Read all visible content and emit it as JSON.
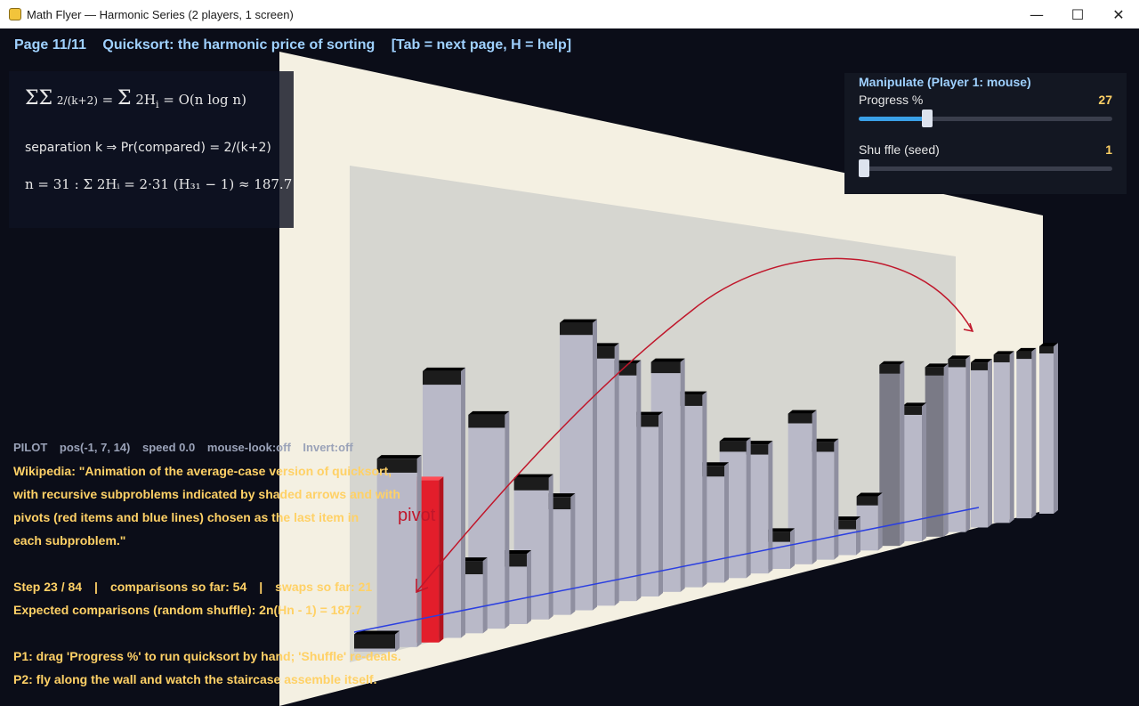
{
  "window": {
    "title": "Math Flyer — Harmonic Series (2 players, 1 screen)",
    "minimize_glyph": "—",
    "maximize_glyph": "☐",
    "close_glyph": "✕",
    "icon": "python-icon"
  },
  "header": {
    "page": "Page 11/11",
    "title": "Quicksort: the harmonic price of sorting",
    "hint": "[Tab = next page,  H = help]"
  },
  "formulas": {
    "f1_rhs": "= O(n log n)",
    "f2_text": "separation k ⇒ Pr(compared) = 2/(k+2)",
    "f3_text": "n = 31 : Σ 2Hᵢ = 2·31 (H₃₁ − 1) ≈ 187.7"
  },
  "manipulate": {
    "title": "Manipulate  (Player 1: mouse)",
    "progress_label": "Progress %",
    "progress_value": 27,
    "shuffle_label": "Shu ffle (seed)",
    "shuffle_value": 1,
    "shuffle_min": 1,
    "shuffle_max": 100
  },
  "pilot": {
    "label": "PILOT",
    "pos": "pos(-1, 7, 14)",
    "speed": "speed 0.0",
    "mouse_look": "mouse-look:off",
    "invert": "Invert:off"
  },
  "wiki": {
    "line1": "Wikipedia: \"Animation of the average-case version of quicksort,",
    "line2": "with recursive subproblems indicated by shaded arrows and with",
    "line3": "pivots (red items and blue lines) chosen as the last item in",
    "line4": "each subproblem.\""
  },
  "stats": {
    "step": "Step 23 / 84",
    "sep1": "|",
    "comparisons": "comparisons so far: 54",
    "sep2": "|",
    "swaps": "swaps so far: 21",
    "expected": "Expected comparisons (random shuffle): 2n(Hn - 1) = 187.7"
  },
  "instructions": {
    "p1": "P1: drag 'Progress %' to run quicksort by hand; 'Shuffle' re-deals.",
    "p2": "P2: fly along the wall and watch the staircase assemble itself."
  },
  "scene": {
    "pivot_label": "pivot",
    "wall_color": "#f4f0e2",
    "panel_color": "#d6d6d0",
    "bar_face": "#b9b9c8",
    "bar_cap": "#1c1c1c",
    "pivot_color": "#e31e2b",
    "arrow_color": "#c0172b",
    "line_color": "#2b3fe0",
    "bar_heights": [
      0.05,
      0.55,
      0.48,
      0.8,
      0.22,
      0.66,
      0.22,
      0.45,
      0.38,
      0.94,
      0.86,
      0.8,
      0.62,
      0.8,
      0.68,
      0.42,
      0.5,
      0.48,
      0.14,
      0.58,
      0.46,
      0.14,
      0.22,
      0.75,
      0.57,
      0.73,
      0.76,
      0.74,
      0.77,
      0.78,
      0.8
    ],
    "bar_dark": [
      false,
      false,
      false,
      false,
      false,
      false,
      false,
      false,
      false,
      false,
      false,
      false,
      false,
      false,
      false,
      false,
      false,
      false,
      false,
      false,
      false,
      false,
      false,
      true,
      false,
      true,
      false,
      false,
      false,
      false,
      false
    ]
  }
}
